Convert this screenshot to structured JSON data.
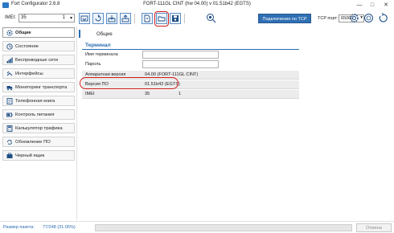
{
  "window": {
    "app_name": "Fort Configurator 2.6.8",
    "title": "FORT-111GL CINT (hw 04.00) v 01.51b42 (EGTS)",
    "controls": [
      "—",
      "□",
      "✕"
    ]
  },
  "toolbar": {
    "imei_label": "IMEI:",
    "imei_value": "35",
    "imei_selected": "1",
    "buttons": [
      "save-to-device-icon",
      "read-from-device-icon",
      "download-icon",
      "upload-icon",
      "new-file-icon",
      "open-folder-icon",
      "save-file-icon",
      "search-device-icon"
    ],
    "tcp_button": "Подключение по TCP",
    "tcp_port_label": "TCP порт:",
    "tcp_port_value": "65060",
    "right_icons": [
      "settings-icon",
      "help-icon",
      "reboot-icon"
    ]
  },
  "sidebar": {
    "items": [
      {
        "label": "Общие",
        "icon": "gear-icon",
        "active": true
      },
      {
        "label": "Состояние",
        "icon": "status-icon",
        "active": false
      },
      {
        "label": "Беспроводные сети",
        "icon": "signal-icon",
        "active": false
      },
      {
        "label": "Интерфейсы",
        "icon": "interfaces-icon",
        "active": false
      },
      {
        "label": "Мониторинг транспорта",
        "icon": "truck-icon",
        "active": false
      },
      {
        "label": "Телефонная книга",
        "icon": "phonebook-icon",
        "active": false
      },
      {
        "label": "Контроль питания",
        "icon": "power-icon",
        "active": false
      },
      {
        "label": "Калькулятор трафика",
        "icon": "calculator-icon",
        "active": false
      },
      {
        "label": "Обновление ПО",
        "icon": "update-icon",
        "active": false
      },
      {
        "label": "Черный ящик",
        "icon": "blackbox-icon",
        "active": false
      }
    ]
  },
  "content": {
    "page_title": "Общие",
    "section_title": "Терминал",
    "rows": [
      {
        "label": "Имя терминала",
        "value": "",
        "value2": "",
        "type": "input"
      },
      {
        "label": "Пароль",
        "value": "",
        "value2": "",
        "type": "input"
      },
      {
        "label": "Аппаратная версия",
        "value": "04.00 (FORT-111GL CINT)",
        "value2": "",
        "type": "text"
      },
      {
        "label": "Версия ПО",
        "value": "01.51b42 (EGTS)",
        "value2": "",
        "type": "text"
      },
      {
        "label": "IMEI",
        "value": "35",
        "value2": "1",
        "type": "text"
      }
    ]
  },
  "status": {
    "packet_size_label": "Размер пакета:",
    "packet_size_value": "77/248 (31.05%)",
    "progress_fraction": 0,
    "cancel_label": "Отмена"
  },
  "colors": {
    "accent": "#2b6cb0",
    "tcp_button": "#2f6fb2",
    "highlight": "#d11a1a"
  }
}
